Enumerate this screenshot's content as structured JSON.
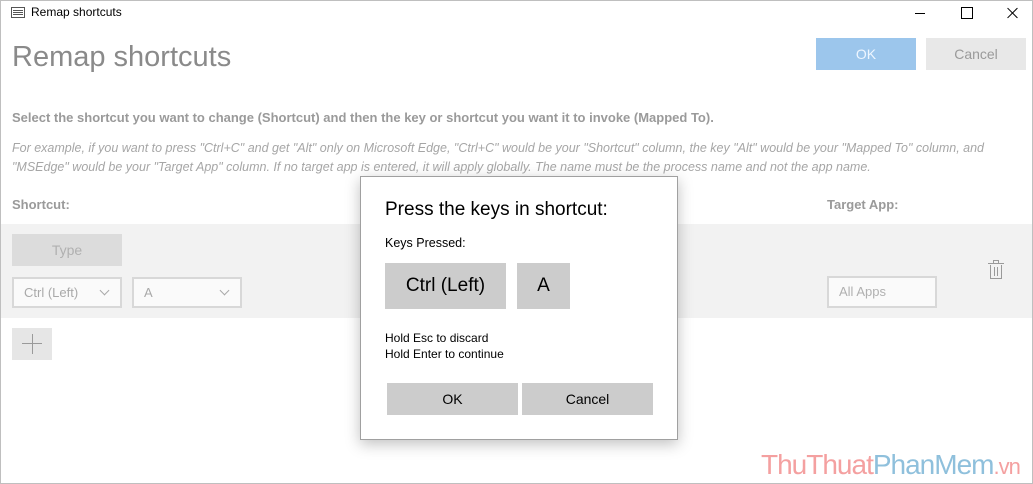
{
  "window": {
    "title": "Remap shortcuts"
  },
  "header": {
    "title": "Remap shortcuts",
    "ok_label": "OK",
    "cancel_label": "Cancel"
  },
  "instructions": {
    "main": "Select the shortcut you want to change (Shortcut) and then the key or shortcut you want it to invoke (Mapped To).",
    "example": "For example, if you want to press \"Ctrl+C\" and get \"Alt\" only on Microsoft Edge, \"Ctrl+C\" would be your \"Shortcut\" column, the key \"Alt\" would be your \"Mapped To\" column, and \"MSEdge\" would be your \"Target App\" column. If no target app is entered, it will apply globally. The name must be the process name and not the app name."
  },
  "columns": {
    "shortcut": "Shortcut:",
    "target_app": "Target App:"
  },
  "row": {
    "type_label": "Type",
    "dropdown_1": "Ctrl (Left)",
    "dropdown_2": "A",
    "target_placeholder": "All Apps"
  },
  "dialog": {
    "title": "Press the keys in shortcut:",
    "keys_label": "Keys Pressed:",
    "keys": [
      "Ctrl (Left)",
      "A"
    ],
    "hint_discard": "Hold Esc to discard",
    "hint_continue": "Hold Enter to continue",
    "ok_label": "OK",
    "cancel_label": "Cancel"
  },
  "watermark": {
    "part1": "ThuThuat",
    "part2": "PhanMem",
    "part3": ".vn"
  },
  "colors": {
    "accent": "#9cc6ec",
    "key_bg": "#cccccc"
  }
}
